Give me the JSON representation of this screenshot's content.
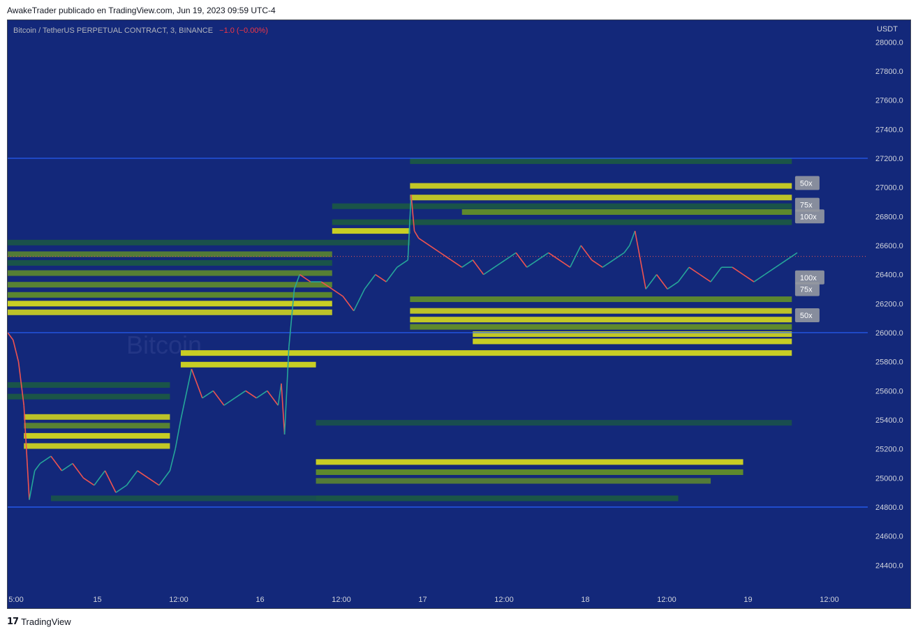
{
  "header": {
    "attribution": "AwakeTrader publicado en TradingView.com, Jun 19, 2023 09:59 UTC-4"
  },
  "footer": {
    "logo_mark": "17",
    "brand": "TradingView"
  },
  "colors": {
    "background": "#13287a",
    "heat_low": "#1f6b2f",
    "heat_mid": "#6e9e1e",
    "heat_high": "#d8dc1c",
    "candle_up": "#26a69a",
    "candle_down": "#ef5350",
    "range_lines": "#2962ff",
    "axis_text": "#d1d4dc",
    "change_text": "#f23645"
  },
  "chart_data": {
    "type": "line",
    "symbol_title": "Bitcoin / TetherUS PERPETUAL CONTRACT, 3, BINANCE",
    "change_text": "−1.0 (−0.00%)",
    "currency_label": "USDT",
    "watermark": "Bitcoin",
    "ylim": [
      24200,
      28150
    ],
    "y_ticks": [
      "28000.0",
      "27800.0",
      "27600.0",
      "27400.0",
      "27200.0",
      "27000.0",
      "26800.0",
      "26600.0",
      "26400.0",
      "26200.0",
      "26000.0",
      "25800.0",
      "25600.0",
      "25400.0",
      "25200.0",
      "25000.0",
      "24800.0",
      "24600.0",
      "24400.0"
    ],
    "x_ticks": [
      "5:00",
      "15",
      "12:00",
      "16",
      "12:00",
      "17",
      "12:00",
      "18",
      "12:00",
      "19",
      "12:00"
    ],
    "grid": false,
    "horizontal_levels": [
      27200,
      26000,
      24800
    ],
    "current_price": 26525,
    "price_series": {
      "x_hours": [
        0,
        0.5,
        1,
        1.5,
        2,
        2.5,
        3,
        4,
        5,
        6,
        7,
        8,
        9,
        10,
        11,
        12,
        13,
        14,
        15,
        15.5,
        16,
        17,
        18,
        19,
        20,
        21,
        22,
        23,
        24,
        25,
        25.3,
        25.6,
        26,
        26.5,
        27,
        28,
        29,
        30,
        31,
        32,
        33,
        34,
        35,
        36,
        37,
        37.3,
        37.6,
        38,
        39,
        40,
        41,
        42,
        43,
        44,
        45,
        46,
        47,
        48,
        49,
        50,
        51,
        52,
        53,
        54,
        55,
        56,
        57,
        57.5,
        58,
        58.5,
        59,
        60,
        61,
        62,
        63,
        64,
        65,
        66,
        67,
        68,
        69,
        70,
        71,
        72,
        73
      ],
      "y": [
        26000,
        25950,
        25800,
        25500,
        24850,
        25050,
        25100,
        25150,
        25050,
        25100,
        25000,
        24950,
        25050,
        24900,
        24950,
        25050,
        25000,
        24950,
        25050,
        25200,
        25400,
        25750,
        25550,
        25600,
        25500,
        25550,
        25600,
        25550,
        25600,
        25500,
        25650,
        25300,
        25900,
        26300,
        26400,
        26350,
        26350,
        26300,
        26250,
        26150,
        26300,
        26400,
        26350,
        26450,
        26500,
        26950,
        26700,
        26650,
        26600,
        26550,
        26500,
        26450,
        26500,
        26400,
        26450,
        26500,
        26550,
        26450,
        26500,
        26550,
        26500,
        26450,
        26600,
        26500,
        26450,
        26500,
        26550,
        26600,
        26700,
        26500,
        26300,
        26400,
        26300,
        26350,
        26450,
        26400,
        26350,
        26450,
        26450,
        26400,
        26350,
        26400,
        26450,
        26500,
        26550,
        26525
      ]
    },
    "liquidation_labels": [
      {
        "text": "50x",
        "price": 27030
      },
      {
        "text": "75x",
        "price": 26880
      },
      {
        "text": "100x",
        "price": 26800
      },
      {
        "text": "100x",
        "price": 26380
      },
      {
        "text": "75x",
        "price": 26300
      },
      {
        "text": "50x",
        "price": 26120
      }
    ],
    "heatmap_bands": [
      {
        "price": 27180,
        "from_h": 37.2,
        "to_h": 72.5,
        "level": 0.55
      },
      {
        "price": 27010,
        "from_h": 37.2,
        "to_h": 72.5,
        "level": 0.9
      },
      {
        "price": 26930,
        "from_h": 37.2,
        "to_h": 72.5,
        "level": 0.85
      },
      {
        "price": 26870,
        "from_h": 30,
        "to_h": 72.5,
        "level": 0.5
      },
      {
        "price": 26830,
        "from_h": 42,
        "to_h": 72.5,
        "level": 0.8
      },
      {
        "price": 26760,
        "from_h": 30,
        "to_h": 72.5,
        "level": 0.55
      },
      {
        "price": 26700,
        "from_h": 30,
        "to_h": 37.2,
        "level": 0.95
      },
      {
        "price": 26620,
        "from_h": 0,
        "to_h": 37.2,
        "level": 0.45
      },
      {
        "price": 26540,
        "from_h": 0,
        "to_h": 30,
        "level": 0.6
      },
      {
        "price": 26480,
        "from_h": 0,
        "to_h": 30,
        "level": 0.5
      },
      {
        "price": 26410,
        "from_h": 0,
        "to_h": 30,
        "level": 0.65
      },
      {
        "price": 26330,
        "from_h": 0,
        "to_h": 30,
        "level": 0.7
      },
      {
        "price": 26260,
        "from_h": 0,
        "to_h": 30,
        "level": 0.75
      },
      {
        "price": 26200,
        "from_h": 0,
        "to_h": 30,
        "level": 0.95
      },
      {
        "price": 26140,
        "from_h": 0,
        "to_h": 30,
        "level": 0.85
      },
      {
        "price": 26230,
        "from_h": 37.2,
        "to_h": 72.5,
        "level": 0.75
      },
      {
        "price": 26150,
        "from_h": 37.2,
        "to_h": 72.5,
        "level": 0.85
      },
      {
        "price": 26090,
        "from_h": 37.2,
        "to_h": 72.5,
        "level": 0.9
      },
      {
        "price": 26040,
        "from_h": 37.2,
        "to_h": 72.5,
        "level": 0.8
      },
      {
        "price": 25990,
        "from_h": 43,
        "to_h": 72.5,
        "level": 0.9
      },
      {
        "price": 25940,
        "from_h": 43,
        "to_h": 72.5,
        "level": 0.95
      },
      {
        "price": 25860,
        "from_h": 16,
        "to_h": 72.5,
        "level": 0.95
      },
      {
        "price": 25780,
        "from_h": 16,
        "to_h": 28.5,
        "level": 0.95
      },
      {
        "price": 25640,
        "from_h": 0,
        "to_h": 15,
        "level": 0.5
      },
      {
        "price": 25560,
        "from_h": 0,
        "to_h": 15,
        "level": 0.55
      },
      {
        "price": 25420,
        "from_h": 1.5,
        "to_h": 15,
        "level": 0.85
      },
      {
        "price": 25360,
        "from_h": 1.5,
        "to_h": 15,
        "level": 0.7
      },
      {
        "price": 25290,
        "from_h": 1.5,
        "to_h": 15,
        "level": 0.95
      },
      {
        "price": 25220,
        "from_h": 1.5,
        "to_h": 15,
        "level": 0.9
      },
      {
        "price": 25380,
        "from_h": 28.5,
        "to_h": 72.5,
        "level": 0.35
      },
      {
        "price": 25110,
        "from_h": 28.5,
        "to_h": 68,
        "level": 0.95
      },
      {
        "price": 25040,
        "from_h": 28.5,
        "to_h": 68,
        "level": 0.8
      },
      {
        "price": 24980,
        "from_h": 28.5,
        "to_h": 65,
        "level": 0.6
      },
      {
        "price": 24860,
        "from_h": 28.5,
        "to_h": 62,
        "level": 0.55
      },
      {
        "price": 24860,
        "from_h": 4,
        "to_h": 28.5,
        "level": 0.4
      }
    ]
  }
}
